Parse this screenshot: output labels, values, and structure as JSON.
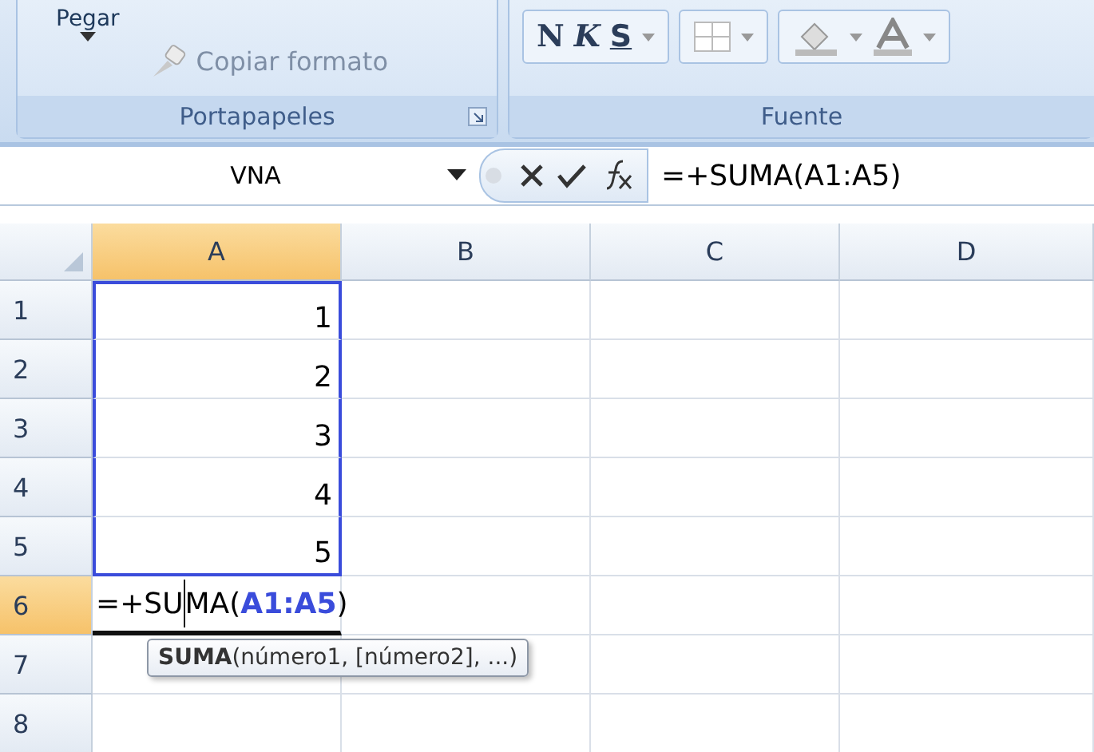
{
  "ribbon": {
    "groups": [
      {
        "label": "Portapapeles",
        "paste_label": "Pegar",
        "copy_format_label": "Copiar formato"
      },
      {
        "label": "Fuente",
        "format_buttons": [
          {
            "text": "N",
            "kind": "bold"
          },
          {
            "text": "K",
            "kind": "italic"
          },
          {
            "text": "S",
            "kind": "underline"
          }
        ]
      }
    ]
  },
  "formula_bar": {
    "name_box": "VNA",
    "formula": "=+SUMA(A1:A5)"
  },
  "columns": [
    {
      "label": "A",
      "selected": true
    },
    {
      "label": "B",
      "selected": false
    },
    {
      "label": "C",
      "selected": false
    },
    {
      "label": "D",
      "selected": false
    }
  ],
  "rows": [
    {
      "label": "1",
      "selected": false,
      "value": "1",
      "in_range": true
    },
    {
      "label": "2",
      "selected": false,
      "value": "2",
      "in_range": true
    },
    {
      "label": "3",
      "selected": false,
      "value": "3",
      "in_range": true
    },
    {
      "label": "4",
      "selected": false,
      "value": "4",
      "in_range": true
    },
    {
      "label": "5",
      "selected": false,
      "value": "5",
      "in_range": true
    },
    {
      "label": "6",
      "selected": true,
      "in_range": false,
      "edit": [
        {
          "kind": "plain",
          "text": "=+SU"
        },
        {
          "kind": "caret"
        },
        {
          "kind": "plain",
          "text": "MA("
        },
        {
          "kind": "ref",
          "text": "A1:A5"
        },
        {
          "kind": "plain",
          "text": ")"
        }
      ]
    },
    {
      "label": "7",
      "selected": false,
      "in_range": false
    },
    {
      "label": "8",
      "selected": false,
      "in_range": false
    }
  ],
  "tooltip": "**SUMA**(número1, [número2], ...)"
}
